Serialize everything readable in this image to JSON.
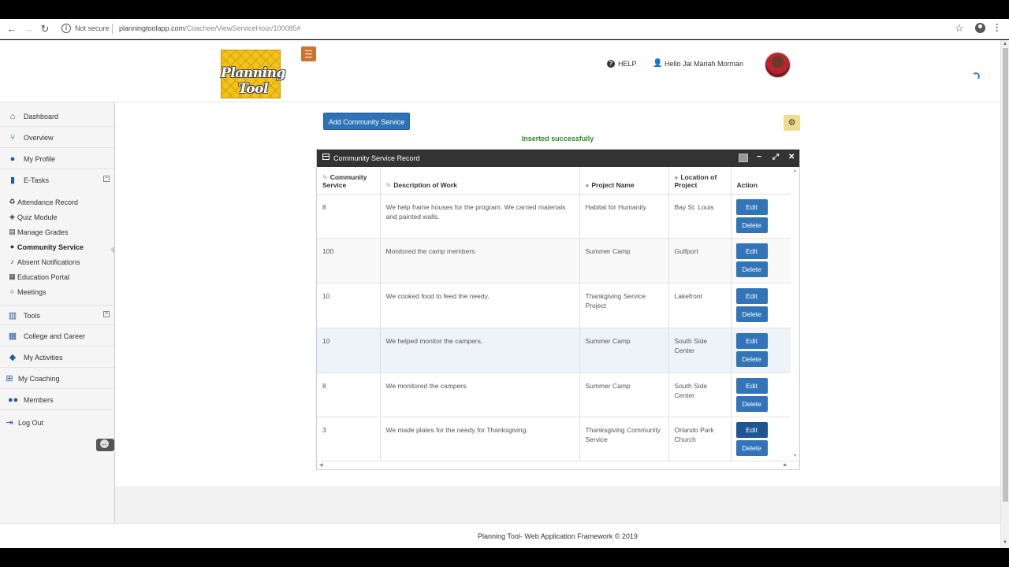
{
  "browser": {
    "security_label": "Not secure",
    "url_host": "planningtoolapp.com",
    "url_path": "/Coachee/ViewServiceHour/100085#"
  },
  "header": {
    "logo_text": "Planning Tool",
    "help_label": "HELP",
    "greeting": "Hello Jai Mariah Morman"
  },
  "sidebar": {
    "items": [
      {
        "label": "Dashboard",
        "icon": "home-icon"
      },
      {
        "label": "Overview",
        "icon": "branch-icon"
      },
      {
        "label": "My Profile",
        "icon": "user-icon"
      },
      {
        "label": "E-Tasks",
        "icon": "bookmark-icon"
      },
      {
        "label": "Tools",
        "icon": "bar-chart-icon"
      },
      {
        "label": "College and Career",
        "icon": "bank-icon"
      },
      {
        "label": "My Activities",
        "icon": "shield-icon"
      },
      {
        "label": "My Coaching",
        "icon": "sitemap-icon"
      },
      {
        "label": "Members",
        "icon": "users-icon"
      },
      {
        "label": "Log Out",
        "icon": "logout-icon"
      }
    ],
    "subitems": [
      {
        "label": "Attendance Record",
        "icon": "recycle-icon"
      },
      {
        "label": "Quiz Module",
        "icon": "cube-icon"
      },
      {
        "label": "Manage Grades",
        "icon": "chart-icon"
      },
      {
        "label": "Community Service",
        "icon": "globe-icon"
      },
      {
        "label": "Absent Notifications",
        "icon": "bell-icon"
      },
      {
        "label": "Education Portal",
        "icon": "book-icon"
      },
      {
        "label": "Meetings",
        "icon": "circle-icon"
      }
    ]
  },
  "main": {
    "add_button_label": "Add Community Service",
    "success_message": "Inserted successfully",
    "widget_title": "Community Service Record",
    "columns": [
      "Community Service",
      "Description of Work",
      "Project Name",
      "Location of Project",
      "Action"
    ],
    "edit_label": "Edit",
    "delete_label": "Delete",
    "rows": [
      {
        "hours": "8",
        "description": "We help frame houses for the program. We carried materials and painted walls.",
        "project": "Habitat for Humanity",
        "location": "Bay St. Louis"
      },
      {
        "hours": "100",
        "description": "Monitored the camp members",
        "project": "Summer Camp",
        "location": "Gulfport"
      },
      {
        "hours": "10",
        "description": "We cooked food to feed the needy.",
        "project": "Thankgiving Service Project",
        "location": "Lakefront"
      },
      {
        "hours": "10",
        "description": "We helped monitor the campers.",
        "project": "Summer Camp",
        "location": "South Side Center"
      },
      {
        "hours": "8",
        "description": "We monitored the campers.",
        "project": "Summer Camp",
        "location": "South Side Center"
      },
      {
        "hours": "3",
        "description": "We made plates for the needy for Thanksgiving.",
        "project": "Thanksgiving Community Service",
        "location": "Orlando Park Church"
      }
    ]
  },
  "footer": {
    "text": "Planning Tool- Web Application Framework © 2019"
  },
  "colors": {
    "primary_button": "#2e72b8",
    "success_text": "#2a8a26",
    "widget_header": "#333333",
    "accent_orange": "#d0722f",
    "sidebar_icon": "#1f5f9e"
  }
}
